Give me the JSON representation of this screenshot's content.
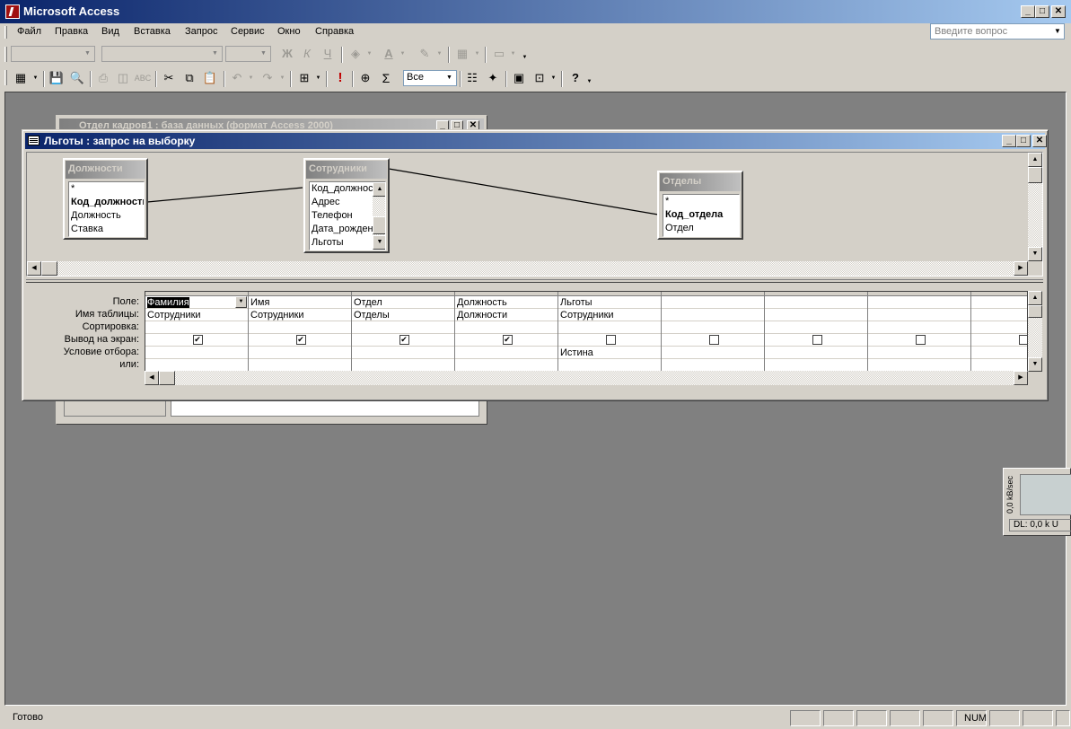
{
  "app": {
    "title": "Microsoft Access"
  },
  "menu": [
    "Файл",
    "Правка",
    "Вид",
    "Вставка",
    "Запрос",
    "Сервис",
    "Окно",
    "Справка"
  ],
  "ask_placeholder": "Введите вопрос",
  "toolbar2": {
    "top_values": "Все"
  },
  "db_window": {
    "title": "Отдел кадров1 : база данных (формат Access 2000)"
  },
  "query_window": {
    "title": "Льготы : запрос на выборку",
    "tables": [
      {
        "name": "Должности",
        "fields": [
          {
            "name": "*",
            "key": false
          },
          {
            "name": "Код_должности",
            "key": true
          },
          {
            "name": "Должность",
            "key": false
          },
          {
            "name": "Ставка",
            "key": false
          }
        ]
      },
      {
        "name": "Сотрудники",
        "fields": [
          {
            "name": "Код_должности",
            "key": false
          },
          {
            "name": "Адрес",
            "key": false
          },
          {
            "name": "Телефон",
            "key": false
          },
          {
            "name": "Дата_рождения",
            "key": false
          },
          {
            "name": "Льготы",
            "key": false
          }
        ]
      },
      {
        "name": "Отделы",
        "fields": [
          {
            "name": "*",
            "key": false
          },
          {
            "name": "Код_отдела",
            "key": true
          },
          {
            "name": "Отдел",
            "key": false
          }
        ]
      }
    ],
    "row_labels": [
      "Поле:",
      "Имя таблицы:",
      "Сортировка:",
      "Вывод на экран:",
      "Условие отбора:",
      "или:"
    ],
    "columns": [
      {
        "field": "Фамилия",
        "table": "Сотрудники",
        "sort": "",
        "show": true,
        "criteria": "",
        "or": ""
      },
      {
        "field": "Имя",
        "table": "Сотрудники",
        "sort": "",
        "show": true,
        "criteria": "",
        "or": ""
      },
      {
        "field": "Отдел",
        "table": "Отделы",
        "sort": "",
        "show": true,
        "criteria": "",
        "or": ""
      },
      {
        "field": "Должность",
        "table": "Должности",
        "sort": "",
        "show": true,
        "criteria": "",
        "or": ""
      },
      {
        "field": "Льготы",
        "table": "Сотрудники",
        "sort": "",
        "show": false,
        "criteria": "Истина",
        "or": ""
      },
      {
        "field": "",
        "table": "",
        "sort": "",
        "show": false,
        "criteria": "",
        "or": ""
      },
      {
        "field": "",
        "table": "",
        "sort": "",
        "show": false,
        "criteria": "",
        "or": ""
      },
      {
        "field": "",
        "table": "",
        "sort": "",
        "show": false,
        "criteria": "",
        "or": ""
      },
      {
        "field": "",
        "table": "",
        "sort": "",
        "show": false,
        "criteria": "",
        "or": ""
      }
    ]
  },
  "dl_widget": {
    "axis": "0,0 kB/sec",
    "label": "DL: 0,0 k  U"
  },
  "status": {
    "text": "Готово",
    "num": "NUM"
  }
}
